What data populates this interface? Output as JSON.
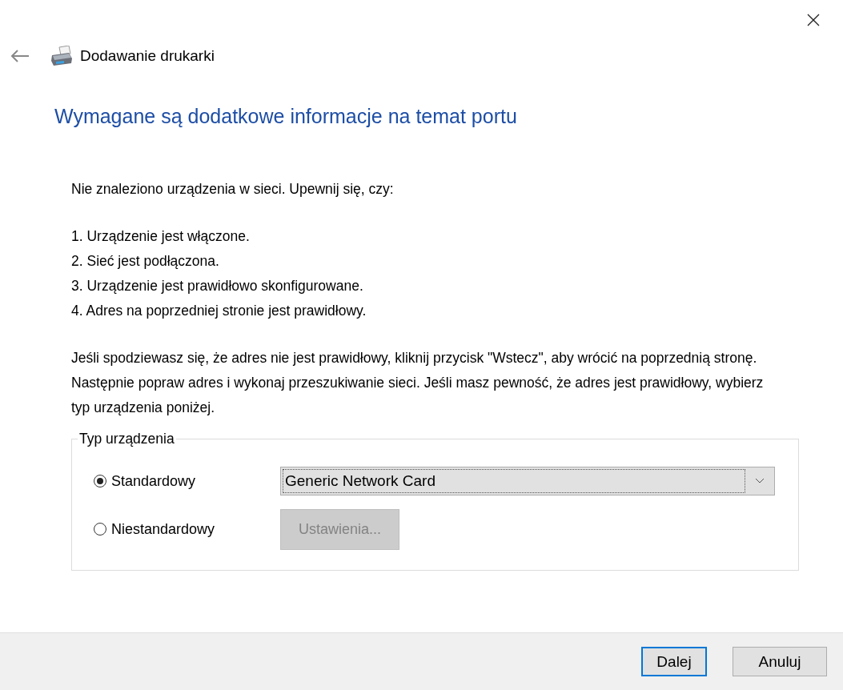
{
  "window": {
    "title": "Dodawanie drukarki"
  },
  "heading": "Wymagane są dodatkowe informacje na temat portu",
  "intro": "Nie znaleziono urządzenia w sieci. Upewnij się, czy:",
  "checklist": [
    "1. Urządzenie jest włączone.",
    "2. Sieć jest podłączona.",
    "3. Urządzenie jest prawidłowo skonfigurowane.",
    "4. Adres na poprzedniej stronie jest prawidłowy."
  ],
  "explanation": "Jeśli spodziewasz się, że adres nie jest prawidłowy, kliknij przycisk \"Wstecz\", aby wrócić na poprzednią stronę. Następnie popraw adres i wykonaj przeszukiwanie sieci. Jeśli masz pewność, że adres jest prawidłowy, wybierz typ urządzenia poniżej.",
  "device_type": {
    "legend": "Typ urządzenia",
    "options": [
      {
        "kind": "dropdown",
        "label": "Standardowy",
        "selected": true,
        "value": "Generic Network Card"
      },
      {
        "kind": "button",
        "label": "Niestandardowy",
        "selected": false,
        "button": "Ustawienia...",
        "disabled": true
      }
    ]
  },
  "buttons": [
    {
      "label": "Dalej",
      "default": true
    },
    {
      "label": "Anuluj",
      "default": false
    }
  ]
}
